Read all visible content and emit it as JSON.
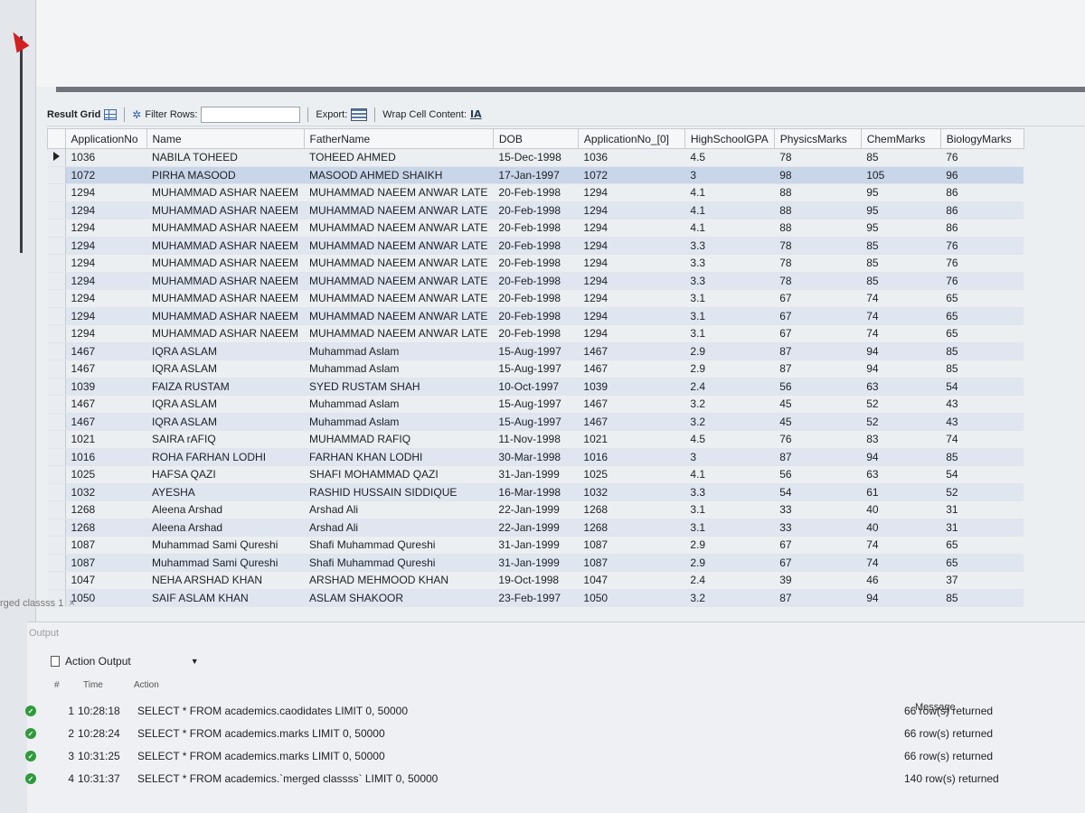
{
  "toolbar": {
    "result_grid": "Result Grid",
    "filter_rows": "Filter Rows:",
    "export": "Export:",
    "wrap_cell": "Wrap Cell Content:"
  },
  "columns": [
    "ApplicationNo",
    "Name",
    "FatherName",
    "DOB",
    "ApplicationNo_[0]",
    "HighSchoolGPA",
    "PhysicsMarks",
    "ChemMarks",
    "BiologyMarks"
  ],
  "rows": [
    [
      "1036",
      "NABILA TOHEED",
      "TOHEED AHMED",
      "15-Dec-1998",
      "1036",
      "4.5",
      "78",
      "85",
      "76"
    ],
    [
      "1072",
      "PIRHA MASOOD",
      "MASOOD AHMED SHAIKH",
      "17-Jan-1997",
      "1072",
      "3",
      "98",
      "105",
      "96"
    ],
    [
      "1294",
      "MUHAMMAD ASHAR NAEEM",
      "MUHAMMAD NAEEM ANWAR LATE",
      "20-Feb-1998",
      "1294",
      "4.1",
      "88",
      "95",
      "86"
    ],
    [
      "1294",
      "MUHAMMAD ASHAR NAEEM",
      "MUHAMMAD NAEEM ANWAR LATE",
      "20-Feb-1998",
      "1294",
      "4.1",
      "88",
      "95",
      "86"
    ],
    [
      "1294",
      "MUHAMMAD ASHAR NAEEM",
      "MUHAMMAD NAEEM ANWAR LATE",
      "20-Feb-1998",
      "1294",
      "4.1",
      "88",
      "95",
      "86"
    ],
    [
      "1294",
      "MUHAMMAD ASHAR NAEEM",
      "MUHAMMAD NAEEM ANWAR LATE",
      "20-Feb-1998",
      "1294",
      "3.3",
      "78",
      "85",
      "76"
    ],
    [
      "1294",
      "MUHAMMAD ASHAR NAEEM",
      "MUHAMMAD NAEEM ANWAR LATE",
      "20-Feb-1998",
      "1294",
      "3.3",
      "78",
      "85",
      "76"
    ],
    [
      "1294",
      "MUHAMMAD ASHAR NAEEM",
      "MUHAMMAD NAEEM ANWAR LATE",
      "20-Feb-1998",
      "1294",
      "3.3",
      "78",
      "85",
      "76"
    ],
    [
      "1294",
      "MUHAMMAD ASHAR NAEEM",
      "MUHAMMAD NAEEM ANWAR LATE",
      "20-Feb-1998",
      "1294",
      "3.1",
      "67",
      "74",
      "65"
    ],
    [
      "1294",
      "MUHAMMAD ASHAR NAEEM",
      "MUHAMMAD NAEEM ANWAR LATE",
      "20-Feb-1998",
      "1294",
      "3.1",
      "67",
      "74",
      "65"
    ],
    [
      "1294",
      "MUHAMMAD ASHAR NAEEM",
      "MUHAMMAD NAEEM ANWAR LATE",
      "20-Feb-1998",
      "1294",
      "3.1",
      "67",
      "74",
      "65"
    ],
    [
      "1467",
      "IQRA ASLAM",
      "Muhammad Aslam",
      "15-Aug-1997",
      "1467",
      "2.9",
      "87",
      "94",
      "85"
    ],
    [
      "1467",
      "IQRA ASLAM",
      "Muhammad Aslam",
      "15-Aug-1997",
      "1467",
      "2.9",
      "87",
      "94",
      "85"
    ],
    [
      "1039",
      "FAIZA RUSTAM",
      "SYED RUSTAM SHAH",
      "10-Oct-1997",
      "1039",
      "2.4",
      "56",
      "63",
      "54"
    ],
    [
      "1467",
      "IQRA ASLAM",
      "Muhammad Aslam",
      "15-Aug-1997",
      "1467",
      "3.2",
      "45",
      "52",
      "43"
    ],
    [
      "1467",
      "IQRA ASLAM",
      "Muhammad Aslam",
      "15-Aug-1997",
      "1467",
      "3.2",
      "45",
      "52",
      "43"
    ],
    [
      "1021",
      "SAIRA rAFIQ",
      "MUHAMMAD RAFIQ",
      "11-Nov-1998",
      "1021",
      "4.5",
      "76",
      "83",
      "74"
    ],
    [
      "1016",
      "ROHA FARHAN LODHI",
      "FARHAN KHAN LODHI",
      "30-Mar-1998",
      "1016",
      "3",
      "87",
      "94",
      "85"
    ],
    [
      "1025",
      "HAFSA QAZI",
      "SHAFI MOHAMMAD QAZI",
      "31-Jan-1999",
      "1025",
      "4.1",
      "56",
      "63",
      "54"
    ],
    [
      "1032",
      "AYESHA",
      "RASHID HUSSAIN SIDDIQUE",
      "16-Mar-1998",
      "1032",
      "3.3",
      "54",
      "61",
      "52"
    ],
    [
      "1268",
      "Aleena Arshad",
      "Arshad Ali",
      "22-Jan-1999",
      "1268",
      "3.1",
      "33",
      "40",
      "31"
    ],
    [
      "1268",
      "Aleena Arshad",
      "Arshad Ali",
      "22-Jan-1999",
      "1268",
      "3.1",
      "33",
      "40",
      "31"
    ],
    [
      "1087",
      "Muhammad Sami Qureshi",
      "Shafi Muhammad Qureshi",
      "31-Jan-1999",
      "1087",
      "2.9",
      "67",
      "74",
      "65"
    ],
    [
      "1087",
      "Muhammad Sami Qureshi",
      "Shafi Muhammad Qureshi",
      "31-Jan-1999",
      "1087",
      "2.9",
      "67",
      "74",
      "65"
    ],
    [
      "1047",
      "NEHA ARSHAD KHAN",
      "ARSHAD MEHMOOD KHAN",
      "19-Oct-1998",
      "1047",
      "2.4",
      "39",
      "46",
      "37"
    ],
    [
      "1050",
      "SAIF ASLAM KHAN",
      "ASLAM SHAKOOR",
      "23-Feb-1997",
      "1050",
      "3.2",
      "87",
      "94",
      "85"
    ]
  ],
  "result_tab": "rged classss 1",
  "output": {
    "section_label": "Output",
    "selector": "Action Output",
    "head_num": "#",
    "head_time": "Time",
    "head_action": "Action",
    "head_message": "Message",
    "entries": [
      {
        "num": "1",
        "time": "10:28:18",
        "action": "SELECT * FROM academics.caodidates LIMIT 0, 50000",
        "message": "66 row(s) returned"
      },
      {
        "num": "2",
        "time": "10:28:24",
        "action": "SELECT * FROM academics.marks LIMIT 0, 50000",
        "message": "66 row(s) returned"
      },
      {
        "num": "3",
        "time": "10:31:25",
        "action": "SELECT * FROM academics.marks LIMIT 0, 50000",
        "message": "66 row(s) returned"
      },
      {
        "num": "4",
        "time": "10:31:37",
        "action": "SELECT * FROM academics.`merged classss` LIMIT 0, 50000",
        "message": "140 row(s) returned"
      }
    ]
  }
}
